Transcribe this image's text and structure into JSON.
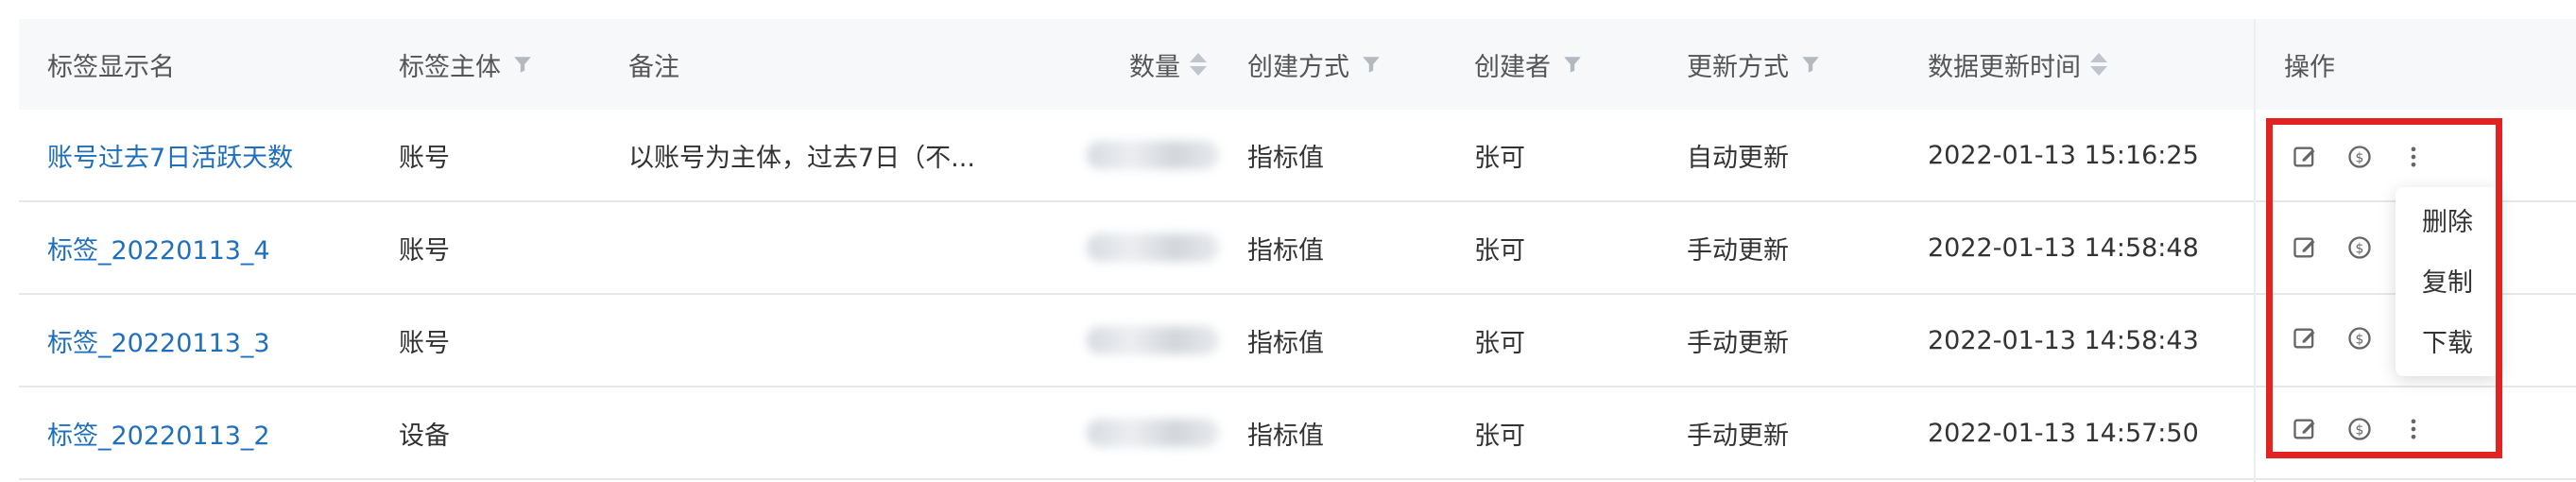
{
  "header": {
    "col_name": "标签显示名",
    "col_subject": "标签主体",
    "col_note": "备注",
    "col_count": "数量",
    "col_create_method": "创建方式",
    "col_creator": "创建者",
    "col_update_method": "更新方式",
    "col_update_time": "数据更新时间",
    "col_actions": "操作"
  },
  "rows": [
    {
      "name": "账号过去7日活跃天数",
      "subject": "账号",
      "note": "以账号为主体，过去7日（不...",
      "create_method": "指标值",
      "creator": "张可",
      "update_method": "自动更新",
      "update_time": "2022-01-13 15:16:25"
    },
    {
      "name": "标签_20220113_4",
      "subject": "账号",
      "note": "",
      "create_method": "指标值",
      "creator": "张可",
      "update_method": "手动更新",
      "update_time": "2022-01-13 14:58:48"
    },
    {
      "name": "标签_20220113_3",
      "subject": "账号",
      "note": "",
      "create_method": "指标值",
      "creator": "张可",
      "update_method": "手动更新",
      "update_time": "2022-01-13 14:58:43"
    },
    {
      "name": "标签_20220113_2",
      "subject": "设备",
      "note": "",
      "create_method": "指标值",
      "creator": "张可",
      "update_method": "手动更新",
      "update_time": "2022-01-13 14:57:50"
    }
  ],
  "menu": {
    "delete": "删除",
    "copy": "复制",
    "download": "下载"
  },
  "icons": {
    "edit": "edit-icon",
    "refresh": "refresh-dollar-icon",
    "more": "more-vertical-icon",
    "filter": "filter-icon",
    "sort": "sort-icon"
  },
  "colors": {
    "link": "#1f6fbf",
    "highlight": "#e32222",
    "header_bg": "#f7f8fa"
  }
}
